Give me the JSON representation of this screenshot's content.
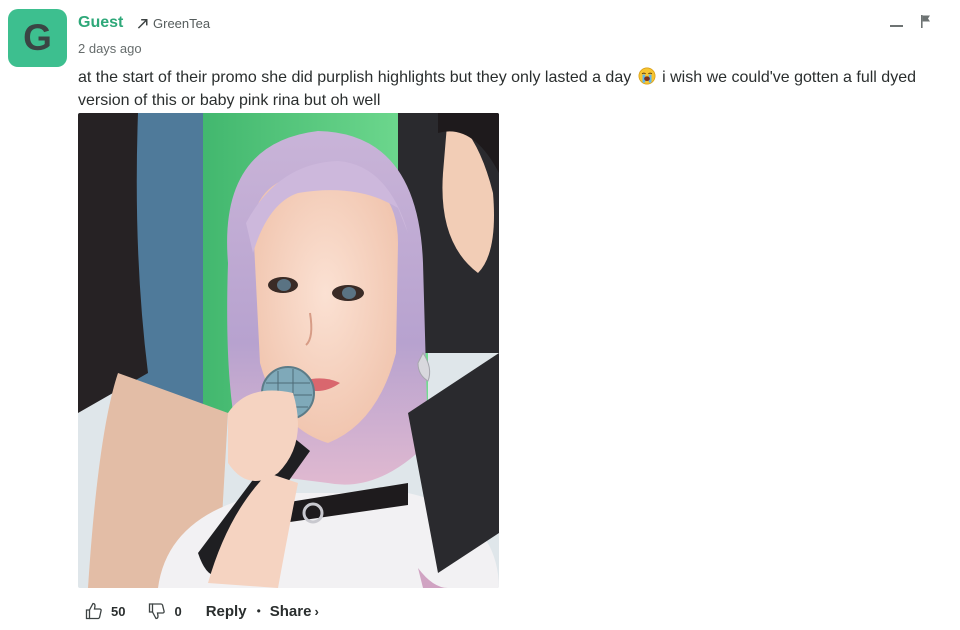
{
  "comment": {
    "avatar_letter": "G",
    "author": "Guest",
    "reply_to": "GreenTea",
    "timestamp": "2 days ago",
    "text_part1": "at the start of their promo she did purplish highlights but they only lasted a day",
    "emoji_icon": "loudly-crying-face-icon",
    "text_part2": "i wish we could've gotten a full dyed version of this or baby pink rina but oh well",
    "image_alt": "photo",
    "upvotes": "50",
    "downvotes": "0",
    "reply_label": "Reply",
    "separator": "•",
    "share_label": "Share",
    "share_chevron": "›"
  },
  "colors": {
    "avatar_bg": "#3dbf8f",
    "author": "#2ea879",
    "text": "#2a2e2e"
  }
}
